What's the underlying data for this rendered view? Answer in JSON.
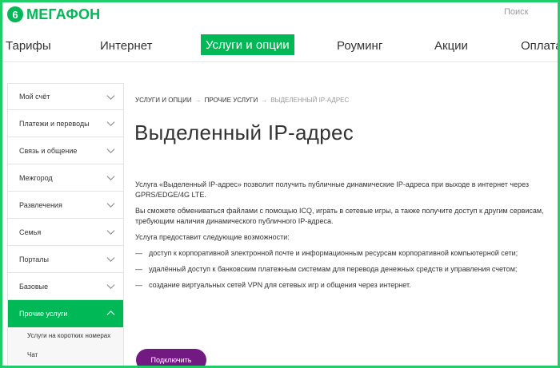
{
  "header": {
    "logo_text": "МегаФон",
    "logo_mark": "6",
    "search_label": "Поиск"
  },
  "nav": [
    {
      "label": "Тарифы"
    },
    {
      "label": "Интернет"
    },
    {
      "label": "Услуги и опции",
      "active": true
    },
    {
      "label": "Роуминг"
    },
    {
      "label": "Акции"
    },
    {
      "label": "Оплата"
    }
  ],
  "sidebar": {
    "items": [
      {
        "label": "Мой счёт"
      },
      {
        "label": "Платежи и переводы"
      },
      {
        "label": "Связь и общение"
      },
      {
        "label": "Межгород"
      },
      {
        "label": "Развлечения"
      },
      {
        "label": "Семья"
      },
      {
        "label": "Порталы"
      },
      {
        "label": "Базовые"
      },
      {
        "label": "Прочие услуги",
        "active": true
      }
    ],
    "subitems": [
      {
        "label": "Услуги на коротких номерах"
      },
      {
        "label": "Чат"
      }
    ]
  },
  "breadcrumb": {
    "items": [
      "УСЛУГИ И ОПЦИИ",
      "ПРОЧИЕ УСЛУГИ",
      "ВЫДЕЛЕННЫЙ IP-АДРЕС"
    ],
    "separator": "→"
  },
  "main": {
    "title": "Выделенный IP-адрес",
    "paragraphs": [
      "Услуга «Выделенный IP-адрес» позволит получить публичные динамические IP-адреса при выходе в интернет через GPRS/EDGE/4G LTE.",
      "Вы сможете обмениваться файлами с помощью ICQ, играть в сетевые игры, а также получите доступ к другим сервисам, требующим наличия динамического публичного IP-адреса.",
      "Услуга предоставит следующие возможности:"
    ],
    "features": [
      "доступ к корпоративной электронной почте и информационным ресурсам корпоративной компьютерной сети;",
      "удалённый доступ к банковским платежным системам для перевода денежных средств и управления счетом;",
      "создание виртуальных сетей VPN для сетевых игр и общения через интернет."
    ],
    "connect_label": "Подключить"
  },
  "colors": {
    "brand_green": "#00b956",
    "frame_green": "#1fce67",
    "brand_purple": "#731982"
  },
  "icons": {
    "sidebar_collapsed": "chevron-down-icon",
    "sidebar_expanded": "chevron-up-icon"
  }
}
